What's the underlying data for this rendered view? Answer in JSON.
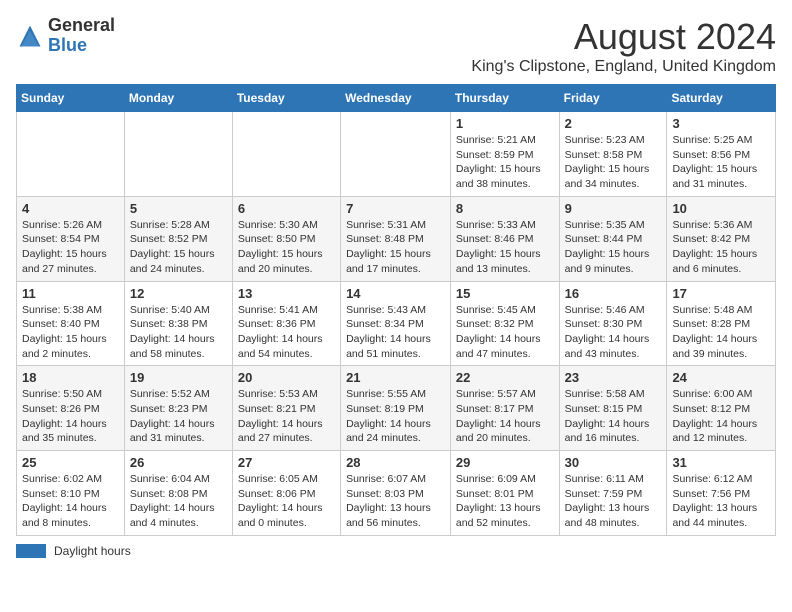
{
  "header": {
    "logo_general": "General",
    "logo_blue": "Blue",
    "month_title": "August 2024",
    "subtitle": "King's Clipstone, England, United Kingdom"
  },
  "columns": [
    "Sunday",
    "Monday",
    "Tuesday",
    "Wednesday",
    "Thursday",
    "Friday",
    "Saturday"
  ],
  "weeks": [
    [
      {
        "day": "",
        "info": ""
      },
      {
        "day": "",
        "info": ""
      },
      {
        "day": "",
        "info": ""
      },
      {
        "day": "",
        "info": ""
      },
      {
        "day": "1",
        "info": "Sunrise: 5:21 AM\nSunset: 8:59 PM\nDaylight: 15 hours\nand 38 minutes."
      },
      {
        "day": "2",
        "info": "Sunrise: 5:23 AM\nSunset: 8:58 PM\nDaylight: 15 hours\nand 34 minutes."
      },
      {
        "day": "3",
        "info": "Sunrise: 5:25 AM\nSunset: 8:56 PM\nDaylight: 15 hours\nand 31 minutes."
      }
    ],
    [
      {
        "day": "4",
        "info": "Sunrise: 5:26 AM\nSunset: 8:54 PM\nDaylight: 15 hours\nand 27 minutes."
      },
      {
        "day": "5",
        "info": "Sunrise: 5:28 AM\nSunset: 8:52 PM\nDaylight: 15 hours\nand 24 minutes."
      },
      {
        "day": "6",
        "info": "Sunrise: 5:30 AM\nSunset: 8:50 PM\nDaylight: 15 hours\nand 20 minutes."
      },
      {
        "day": "7",
        "info": "Sunrise: 5:31 AM\nSunset: 8:48 PM\nDaylight: 15 hours\nand 17 minutes."
      },
      {
        "day": "8",
        "info": "Sunrise: 5:33 AM\nSunset: 8:46 PM\nDaylight: 15 hours\nand 13 minutes."
      },
      {
        "day": "9",
        "info": "Sunrise: 5:35 AM\nSunset: 8:44 PM\nDaylight: 15 hours\nand 9 minutes."
      },
      {
        "day": "10",
        "info": "Sunrise: 5:36 AM\nSunset: 8:42 PM\nDaylight: 15 hours\nand 6 minutes."
      }
    ],
    [
      {
        "day": "11",
        "info": "Sunrise: 5:38 AM\nSunset: 8:40 PM\nDaylight: 15 hours\nand 2 minutes."
      },
      {
        "day": "12",
        "info": "Sunrise: 5:40 AM\nSunset: 8:38 PM\nDaylight: 14 hours\nand 58 minutes."
      },
      {
        "day": "13",
        "info": "Sunrise: 5:41 AM\nSunset: 8:36 PM\nDaylight: 14 hours\nand 54 minutes."
      },
      {
        "day": "14",
        "info": "Sunrise: 5:43 AM\nSunset: 8:34 PM\nDaylight: 14 hours\nand 51 minutes."
      },
      {
        "day": "15",
        "info": "Sunrise: 5:45 AM\nSunset: 8:32 PM\nDaylight: 14 hours\nand 47 minutes."
      },
      {
        "day": "16",
        "info": "Sunrise: 5:46 AM\nSunset: 8:30 PM\nDaylight: 14 hours\nand 43 minutes."
      },
      {
        "day": "17",
        "info": "Sunrise: 5:48 AM\nSunset: 8:28 PM\nDaylight: 14 hours\nand 39 minutes."
      }
    ],
    [
      {
        "day": "18",
        "info": "Sunrise: 5:50 AM\nSunset: 8:26 PM\nDaylight: 14 hours\nand 35 minutes."
      },
      {
        "day": "19",
        "info": "Sunrise: 5:52 AM\nSunset: 8:23 PM\nDaylight: 14 hours\nand 31 minutes."
      },
      {
        "day": "20",
        "info": "Sunrise: 5:53 AM\nSunset: 8:21 PM\nDaylight: 14 hours\nand 27 minutes."
      },
      {
        "day": "21",
        "info": "Sunrise: 5:55 AM\nSunset: 8:19 PM\nDaylight: 14 hours\nand 24 minutes."
      },
      {
        "day": "22",
        "info": "Sunrise: 5:57 AM\nSunset: 8:17 PM\nDaylight: 14 hours\nand 20 minutes."
      },
      {
        "day": "23",
        "info": "Sunrise: 5:58 AM\nSunset: 8:15 PM\nDaylight: 14 hours\nand 16 minutes."
      },
      {
        "day": "24",
        "info": "Sunrise: 6:00 AM\nSunset: 8:12 PM\nDaylight: 14 hours\nand 12 minutes."
      }
    ],
    [
      {
        "day": "25",
        "info": "Sunrise: 6:02 AM\nSunset: 8:10 PM\nDaylight: 14 hours\nand 8 minutes."
      },
      {
        "day": "26",
        "info": "Sunrise: 6:04 AM\nSunset: 8:08 PM\nDaylight: 14 hours\nand 4 minutes."
      },
      {
        "day": "27",
        "info": "Sunrise: 6:05 AM\nSunset: 8:06 PM\nDaylight: 14 hours\nand 0 minutes."
      },
      {
        "day": "28",
        "info": "Sunrise: 6:07 AM\nSunset: 8:03 PM\nDaylight: 13 hours\nand 56 minutes."
      },
      {
        "day": "29",
        "info": "Sunrise: 6:09 AM\nSunset: 8:01 PM\nDaylight: 13 hours\nand 52 minutes."
      },
      {
        "day": "30",
        "info": "Sunrise: 6:11 AM\nSunset: 7:59 PM\nDaylight: 13 hours\nand 48 minutes."
      },
      {
        "day": "31",
        "info": "Sunrise: 6:12 AM\nSunset: 7:56 PM\nDaylight: 13 hours\nand 44 minutes."
      }
    ]
  ],
  "legend": {
    "label": "Daylight hours"
  }
}
